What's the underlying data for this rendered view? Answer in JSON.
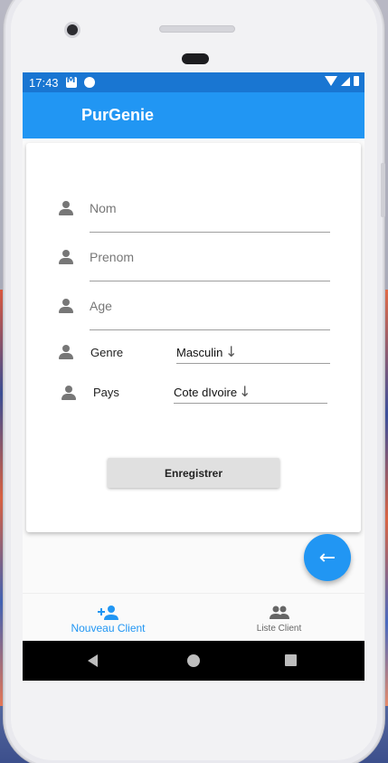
{
  "status_bar": {
    "time": "17:43"
  },
  "app_bar": {
    "title": "PurGenie"
  },
  "form": {
    "nom_label": "Nom",
    "prenom_label": "Prenom",
    "age_label": "Age",
    "genre_label": "Genre",
    "genre_value": "Masculin",
    "pays_label": "Pays",
    "pays_value": "Cote dIvoire",
    "save_label": "Enregistrer"
  },
  "fab": {
    "icon": "arrow-back-icon"
  },
  "bottom_nav": {
    "items": [
      {
        "label": "Nouveau Client",
        "icon": "person-add-icon",
        "active": true
      },
      {
        "label": "Liste Client",
        "icon": "people-icon",
        "active": false
      }
    ]
  },
  "colors": {
    "primary": "#2196f3",
    "status_bar": "#1976d2",
    "button_bg": "#e0e0e0"
  }
}
